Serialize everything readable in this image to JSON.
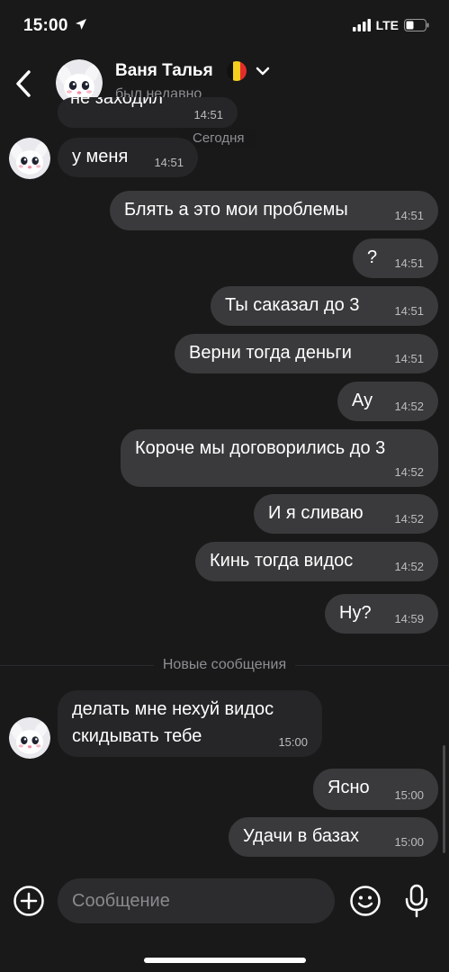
{
  "status_bar": {
    "time": "15:00",
    "network": "LTE"
  },
  "header": {
    "name": "Ваня Талья",
    "status": "был недавно"
  },
  "date_label": "Сегодня",
  "partial_message": {
    "text": "не заходил",
    "time": "14:51"
  },
  "messages": [
    {
      "dir": "in",
      "lines": [
        "у меня"
      ],
      "time": "14:51"
    },
    {
      "dir": "out",
      "lines": [
        "Блять а это мои проблемы"
      ],
      "time": "14:51"
    },
    {
      "dir": "out",
      "lines": [
        "?"
      ],
      "time": "14:51"
    },
    {
      "dir": "out",
      "lines": [
        "Ты саказал до 3"
      ],
      "time": "14:51"
    },
    {
      "dir": "out",
      "lines": [
        "Верни тогда деньги"
      ],
      "time": "14:51"
    },
    {
      "dir": "out",
      "lines": [
        "Ау"
      ],
      "time": "14:52"
    },
    {
      "dir": "out",
      "lines": [
        "Короче мы договорились до 3"
      ],
      "time": "14:52"
    },
    {
      "dir": "out",
      "lines": [
        "И я сливаю"
      ],
      "time": "14:52"
    },
    {
      "dir": "out",
      "lines": [
        "Кинь тогда видос"
      ],
      "time": "14:52"
    },
    {
      "dir": "out",
      "lines": [
        "Ну?"
      ],
      "time": "14:59"
    },
    {
      "dir": "in",
      "lines": [
        "делать мне нехуй видос",
        "скидывать тебе"
      ],
      "time": "15:00"
    },
    {
      "dir": "out",
      "lines": [
        "Ясно"
      ],
      "time": "15:00"
    },
    {
      "dir": "out",
      "lines": [
        "Удачи в базах"
      ],
      "time": "15:00"
    }
  ],
  "new_messages_label": "Новые сообщения",
  "composer": {
    "placeholder": "Сообщение"
  },
  "colors": {
    "background": "#19191a",
    "incoming_bubble": "#262628",
    "outgoing_bubble": "#3a3a3c",
    "muted_text": "#8e8e93"
  },
  "icons": [
    "location-arrow-icon",
    "signal-icon",
    "battery-icon",
    "back-chevron-icon",
    "flag-icon",
    "chevron-down-icon",
    "plus-icon",
    "emoji-icon",
    "microphone-icon"
  ]
}
